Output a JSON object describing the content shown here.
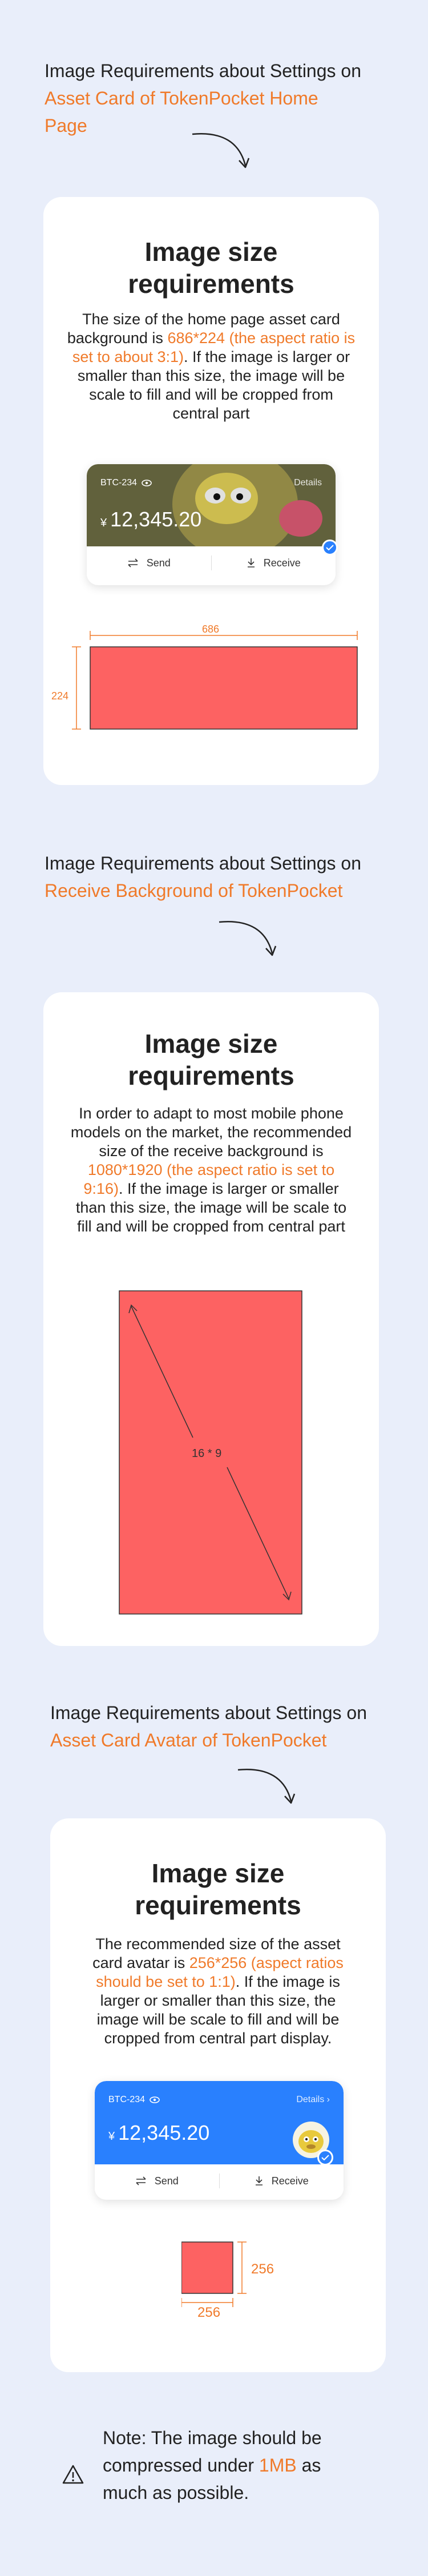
{
  "section1": {
    "title_plain": "Image Requirements about Settings on ",
    "title_highlight": "Asset Card of TokenPocket Home Page",
    "heading": "Image size requirements",
    "desc_before": "The size of the home page asset card background is ",
    "desc_highlight": "686*224 (the aspect ratio is set to about 3:1)",
    "desc_after": ". If the image is larger or smaller than this size, the image will be scale to fill and will be cropped from central part",
    "card": {
      "token": "BTC-234",
      "details": "Details",
      "currency": "¥",
      "balance": "12,345.20",
      "send": "Send",
      "receive": "Receive"
    },
    "width_label": "686",
    "height_label": "224"
  },
  "section2": {
    "title_plain": "Image Requirements about Settings on ",
    "title_highlight": "Receive Background of TokenPocket",
    "heading": "Image size requirements",
    "desc_before": "In order to adapt to most mobile phone models on the market, the recommended size of the receive background is ",
    "desc_highlight": "1080*1920 (the aspect ratio is set to 9:16)",
    "desc_after": ". If the image is larger or smaller than this size, the image will be scale to fill and will be cropped from central part",
    "ratio_label": "16 * 9"
  },
  "section3": {
    "title_plain": "Image Requirements about Settings on ",
    "title_highlight": "Asset Card Avatar of TokenPocket",
    "heading": "Image size requirements",
    "desc_before": "The recommended size of the asset card avatar is ",
    "desc_highlight": "256*256 (aspect ratios should be set to 1:1)",
    "desc_after": ". If the image is larger or smaller than this size, the image will be scale to fill and will be cropped from central part display.",
    "card": {
      "token": "BTC-234",
      "details": "Details",
      "currency": "¥",
      "balance": "12,345.20",
      "send": "Send",
      "receive": "Receive"
    },
    "width_label": "256",
    "height_label": "256"
  },
  "note": {
    "before": "Note: The image should be compressed under ",
    "highlight": "1MB",
    "after": " as much as possible."
  },
  "colors": {
    "accent": "#f07a2a",
    "sample_fill": "#fd6262",
    "brand_blue": "#2980fe",
    "background": "#e9eefa"
  }
}
